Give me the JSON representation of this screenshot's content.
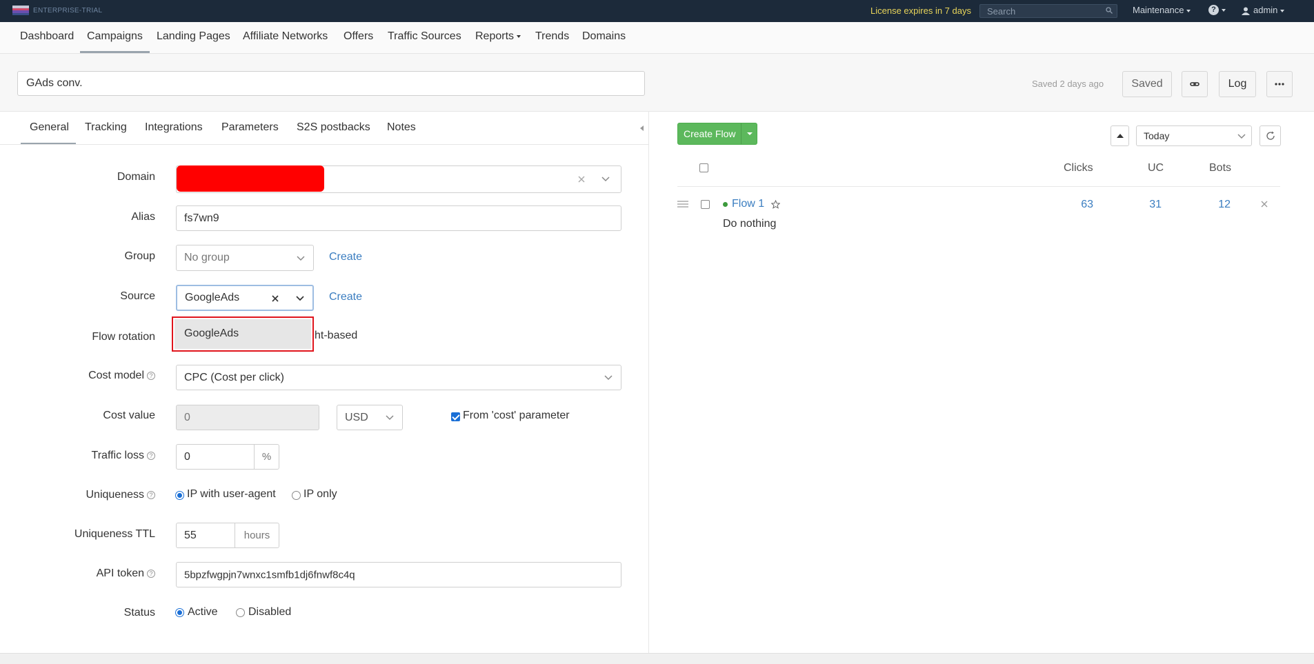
{
  "topbar": {
    "logo_text": "ENTERPRISE-TRIAL",
    "license": "License expires in 7 days",
    "search_placeholder": "Search",
    "maintenance": "Maintenance",
    "user": "admin"
  },
  "nav": {
    "items": [
      "Dashboard",
      "Campaigns",
      "Landing Pages",
      "Affiliate Networks",
      "Offers",
      "Traffic Sources",
      "Reports",
      "Trends",
      "Domains"
    ],
    "active": "Campaigns"
  },
  "header": {
    "campaign_name": "GAds conv.",
    "saved_ago": "Saved 2 days ago",
    "saved_button": "Saved",
    "log_button": "Log"
  },
  "tabs": {
    "items": [
      "General",
      "Tracking",
      "Integrations",
      "Parameters",
      "S2S postbacks",
      "Notes"
    ],
    "active": "General"
  },
  "form": {
    "domain_label": "Domain",
    "alias_label": "Alias",
    "alias_value": "fs7wn9",
    "group_label": "Group",
    "group_value": "No group",
    "group_create": "Create",
    "source_label": "Source",
    "source_value": "GoogleAds",
    "source_create": "Create",
    "source_options": [
      "GoogleAds"
    ],
    "flow_rotation_label": "Flow rotation",
    "flow_rotation_partial": "ht-based",
    "cost_model_label": "Cost model",
    "cost_model_value": "CPC (Cost per click)",
    "cost_value_label": "Cost value",
    "cost_value": "0",
    "currency": "USD",
    "from_cost_param": "From 'cost' parameter",
    "from_cost_param_checked": true,
    "traffic_loss_label": "Traffic loss",
    "traffic_loss_value": "0",
    "traffic_loss_unit": "%",
    "uniqueness_label": "Uniqueness",
    "uniqueness_options": [
      "IP with user-agent",
      "IP only"
    ],
    "uniqueness_selected": "IP with user-agent",
    "uniqueness_ttl_label": "Uniqueness TTL",
    "uniqueness_ttl_value": "55",
    "uniqueness_ttl_unit": "hours",
    "api_token_label": "API token",
    "api_token_value": "5bpzfwgpjn7wnxc1smfb1dj6fnwf8c4q",
    "status_label": "Status",
    "status_options": [
      "Active",
      "Disabled"
    ],
    "status_selected": "Active"
  },
  "flows": {
    "create_button": "Create Flow",
    "period": "Today",
    "columns": [
      "Clicks",
      "UC",
      "Bots"
    ],
    "rows": [
      {
        "name": "Flow 1",
        "action": "Do nothing",
        "clicks": "63",
        "uc": "31",
        "bots": "12",
        "status_color": "#3c9a3c"
      }
    ]
  },
  "colors": {
    "topbar": "#1c2a3a",
    "license": "#e8d45a",
    "link": "#3a7dc0",
    "create_flow": "#5cb85c",
    "dropdown_highlight": "#e0141c",
    "redaction": "#ff0000"
  }
}
